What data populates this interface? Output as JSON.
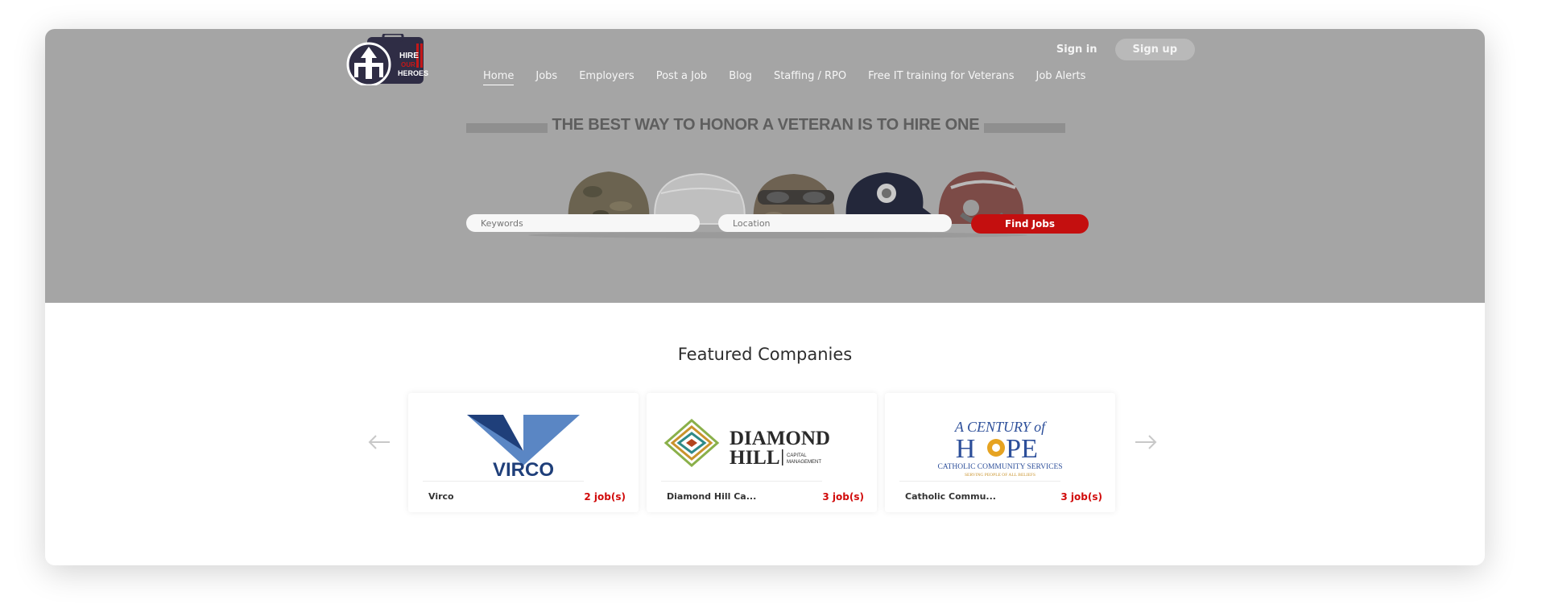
{
  "header": {
    "logo_text": [
      "HIRE",
      "OUR",
      "HEROES"
    ],
    "sign_in": "Sign in",
    "sign_up": "Sign up"
  },
  "nav": {
    "items": [
      {
        "label": "Home",
        "active": true
      },
      {
        "label": "Jobs"
      },
      {
        "label": "Employers"
      },
      {
        "label": "Post a Job"
      },
      {
        "label": "Blog"
      },
      {
        "label": "Staffing / RPO"
      },
      {
        "label": "Free IT training for Veterans"
      },
      {
        "label": "Job Alerts"
      }
    ]
  },
  "hero": {
    "banner": "THE BEST WAY TO HONOR A VETERAN IS TO HIRE ONE",
    "keywords_placeholder": "Keywords",
    "location_placeholder": "Location",
    "find_jobs": "Find Jobs"
  },
  "featured": {
    "title": "Featured Companies",
    "companies": [
      {
        "name": "Virco",
        "jobs": "2 job(s)",
        "logo_text": "VIRCO"
      },
      {
        "name": "Diamond Hill Ca...",
        "jobs": "3 job(s)",
        "logo_text": [
          "DIAMOND",
          "HILL",
          "CAPITAL",
          "MANAGEMENT"
        ]
      },
      {
        "name": "Catholic Commu...",
        "jobs": "3 job(s)",
        "logo_text": [
          "A CENTURY of",
          "H",
          "PE",
          "CATHOLIC COMMUNITY SERVICES",
          "SERVING PEOPLE OF ALL BELIEFS"
        ]
      }
    ]
  },
  "colors": {
    "hero_bg": "#a5a5a5",
    "accent_red": "#c40f0f",
    "jobs_red": "#d10b0b"
  }
}
